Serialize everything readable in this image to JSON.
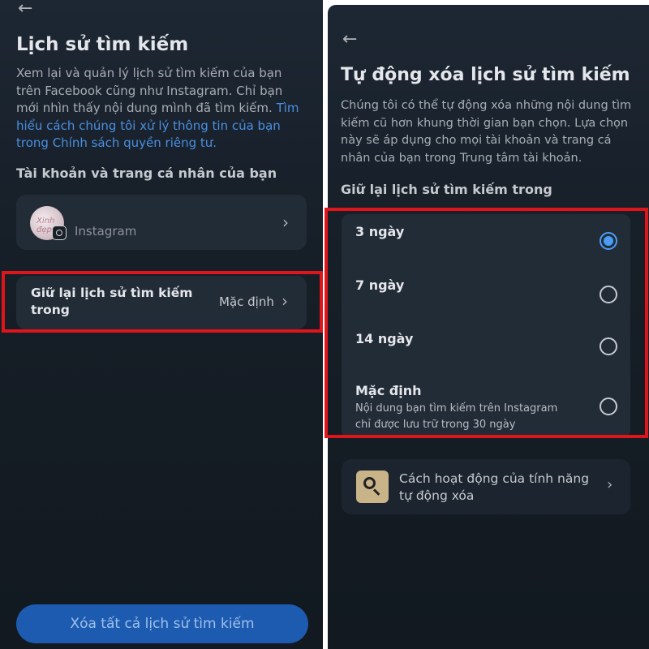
{
  "left": {
    "back_icon": "arrow-left-icon",
    "title": "Lịch sử tìm kiếm",
    "description": "Xem lại và quản lý lịch sử tìm kiếm của bạn trên Facebook cũng như Instagram. Chỉ bạn mới nhìn thấy nội dung mình đã tìm kiếm.",
    "description_link": "Tìm hiểu cách chúng tôi xử lý thông tin của bạn trong Chính sách quyền riêng tư.",
    "accounts_heading": "Tài khoản và trang cá nhân của bạn",
    "account": {
      "name": "Instagram",
      "avatar_text": "Xinh đẹp"
    },
    "retention_row": {
      "label": "Giữ lại lịch sử tìm kiếm trong",
      "value": "Mặc định"
    },
    "clear_button": "Xóa tất cả lịch sử tìm kiếm"
  },
  "right": {
    "back_icon": "arrow-left-icon",
    "title": "Tự động xóa lịch sử tìm kiếm",
    "description": "Chúng tôi có thể tự động xóa những nội dung tìm kiếm cũ hơn khung thời gian bạn chọn. Lựa chọn này sẽ áp dụng cho mọi tài khoản và trang cá nhân của bạn trong Trung tâm tài khoản.",
    "options_heading": "Giữ lại lịch sử tìm kiếm trong",
    "options": [
      {
        "label": "3 ngày",
        "selected": true
      },
      {
        "label": "7 ngày",
        "selected": false
      },
      {
        "label": "14 ngày",
        "selected": false
      },
      {
        "label": "Mặc định",
        "desc": "Nội dung bạn tìm kiếm trên Instagram chỉ được lưu trữ trong 30 ngày",
        "selected": false
      }
    ],
    "help_link": "Cách hoạt động của tính năng tự động xóa"
  },
  "colors": {
    "highlight": "#e0141b",
    "accent": "#4b9cf5",
    "link": "#4a8fe0"
  }
}
